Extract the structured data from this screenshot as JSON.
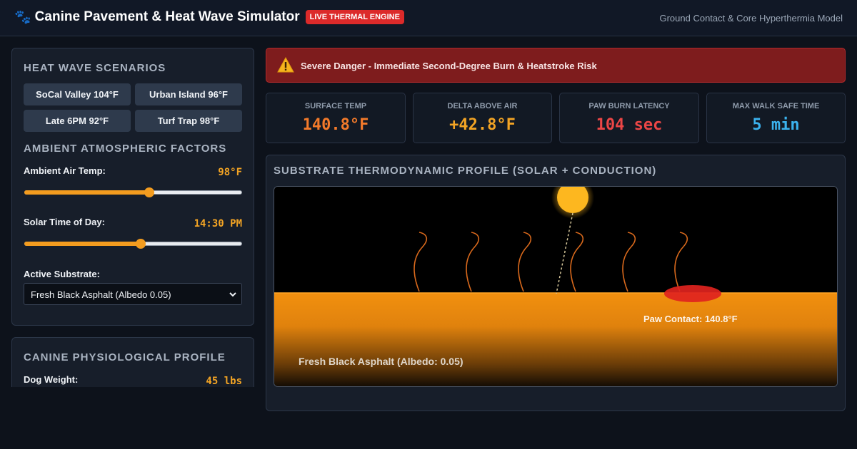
{
  "header": {
    "icon": "paw-icon",
    "title": "Canine Pavement & Heat Wave Simulator",
    "badge": "LIVE THERMAL ENGINE",
    "subtitle": "Ground Contact & Core Hyperthermia Model"
  },
  "scenarios": {
    "heading": "HEAT WAVE SCENARIOS",
    "buttons": [
      "SoCal Valley 104°F",
      "Urban Island 96°F",
      "Late 6PM 92°F",
      "Turf Trap 98°F"
    ]
  },
  "ambient": {
    "heading": "AMBIENT ATMOSPHERIC FACTORS",
    "air_temp": {
      "label": "Ambient Air Temp:",
      "value": "98°F",
      "fraction": 0.575
    },
    "solar_time": {
      "label": "Solar Time of Day:",
      "value": "14:30 PM",
      "fraction": 0.535
    },
    "substrate": {
      "label": "Active Substrate:",
      "selected": "Fresh Black Asphalt (Albedo 0.05)"
    }
  },
  "physiology": {
    "heading": "CANINE PHYSIOLOGICAL PROFILE",
    "weight": {
      "label": "Dog Weight:",
      "value": "45 lbs"
    }
  },
  "alert": {
    "icon": "warning-icon",
    "text": "Severe Danger - Immediate Second-Degree Burn & Heatstroke Risk"
  },
  "metrics": [
    {
      "label": "SURFACE TEMP",
      "value": "140.8°F",
      "color": "#f37a2a"
    },
    {
      "label": "DELTA ABOVE AIR",
      "value": "+42.8°F",
      "color": "#f3a424"
    },
    {
      "label": "PAW BURN LATENCY",
      "value": "104 sec",
      "color": "#ec4646"
    },
    {
      "label": "MAX WALK SAFE TIME",
      "value": "5 min",
      "color": "#3bb2ee"
    }
  ],
  "visualization": {
    "heading": "SUBSTRATE THERMODYNAMIC PROFILE (SOLAR + CONDUCTION)",
    "paw_label": "Paw Contact: 140.8°F",
    "substrate_label": "Fresh Black Asphalt (Albedo: 0.05)",
    "colors": {
      "sun": "#fdb71f",
      "ground_top": "#f2900f",
      "heat_wave": "#d9691c",
      "paw": "#e0231e"
    }
  }
}
